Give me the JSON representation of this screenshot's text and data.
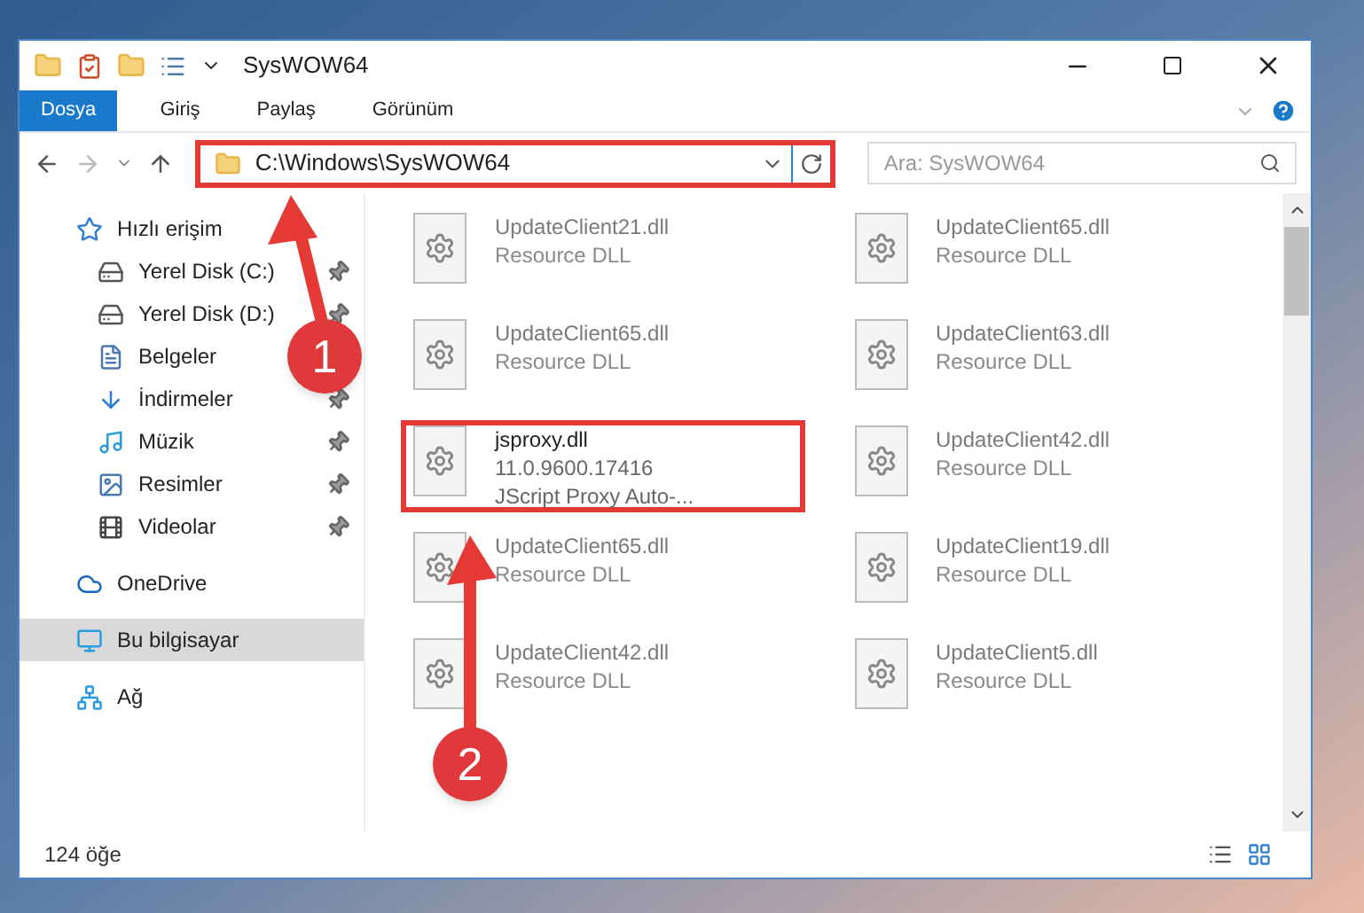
{
  "window": {
    "title": "SysWOW64"
  },
  "ribbon_tabs": [
    {
      "label": "Dosya",
      "selected": true
    },
    {
      "label": "Giriş",
      "selected": false
    },
    {
      "label": "Paylaş",
      "selected": false
    },
    {
      "label": "Görünüm",
      "selected": false
    }
  ],
  "address_bar": {
    "path": "C:\\Windows\\SysWOW64",
    "highlighted": true
  },
  "search": {
    "placeholder": "Ara: SysWOW64"
  },
  "sidebar": {
    "items": [
      {
        "kind": "star",
        "label": "Hızlı erişim",
        "selected": false,
        "children": [
          {
            "kind": "disk-c",
            "label": "Yerel Disk (C:)",
            "pinned": true
          },
          {
            "kind": "disk",
            "label": "Yerel Disk (D:)",
            "pinned": true
          },
          {
            "kind": "docs",
            "label": "Belgeler",
            "pinned": false
          },
          {
            "kind": "download",
            "label": "İndirmeler",
            "pinned": true
          },
          {
            "kind": "music",
            "label": "Müzik",
            "pinned": true
          },
          {
            "kind": "pictures",
            "label": "Resimler",
            "pinned": true
          },
          {
            "kind": "videos",
            "label": "Videolar",
            "pinned": true
          }
        ]
      },
      {
        "kind": "cloud",
        "label": "OneDrive",
        "selected": false
      },
      {
        "kind": "pc",
        "label": "Bu bilgisayar",
        "selected": true
      },
      {
        "kind": "network",
        "label": "Ağ",
        "selected": false
      }
    ]
  },
  "files": [
    {
      "name": "UpdateClient21.dll",
      "lines": [
        "Resource DLL"
      ],
      "dimmed": true,
      "highlighted": false
    },
    {
      "name": "UpdateClient65.dll",
      "lines": [
        "Resource DLL"
      ],
      "dimmed": true,
      "highlighted": false
    },
    {
      "name": "UpdateClient65.dll",
      "lines": [
        "Resource DLL"
      ],
      "dimmed": true,
      "highlighted": false
    },
    {
      "name": "UpdateClient63.dll",
      "lines": [
        "Resource DLL"
      ],
      "dimmed": true,
      "highlighted": false
    },
    {
      "name": "jsproxy.dll",
      "lines": [
        "11.0.9600.17416",
        "JScript Proxy Auto-..."
      ],
      "dimmed": false,
      "highlighted": true
    },
    {
      "name": "UpdateClient42.dll",
      "lines": [
        "Resource DLL"
      ],
      "dimmed": true,
      "highlighted": false
    },
    {
      "name": "UpdateClient65.dll",
      "lines": [
        "Resource DLL"
      ],
      "dimmed": true,
      "highlighted": false
    },
    {
      "name": "UpdateClient19.dll",
      "lines": [
        "Resource DLL"
      ],
      "dimmed": true,
      "highlighted": false
    },
    {
      "name": "UpdateClient42.dll",
      "lines": [
        "Resource DLL"
      ],
      "dimmed": true,
      "highlighted": false
    },
    {
      "name": "UpdateClient5.dll",
      "lines": [
        "Resource DLL"
      ],
      "dimmed": true,
      "highlighted": false
    }
  ],
  "status_bar": {
    "count": "124 öğe"
  },
  "callouts": [
    {
      "label": "1"
    },
    {
      "label": "2"
    }
  ]
}
